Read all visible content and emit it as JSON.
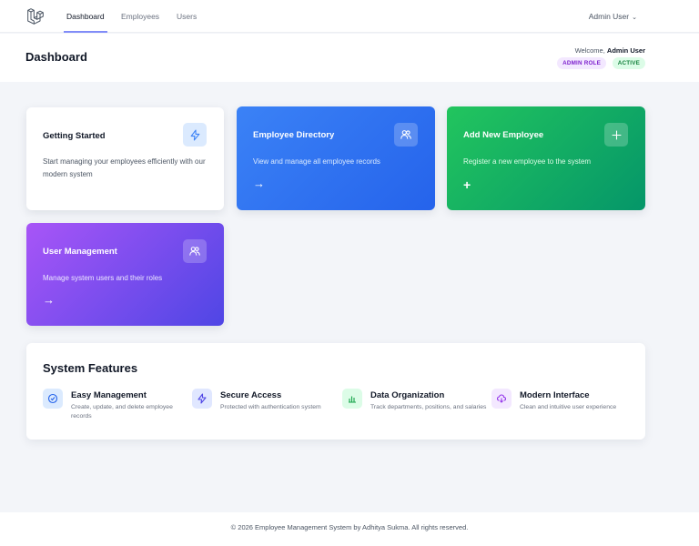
{
  "nav": {
    "logo_icon": "laravel-logo-icon",
    "links": [
      "Dashboard",
      "Employees",
      "Users"
    ],
    "active": "Dashboard",
    "user_menu": "Admin User"
  },
  "header": {
    "title": "Dashboard",
    "welcome_prefix": "Welcome,",
    "welcome_name": "Admin User",
    "role_badge": "ADMIN ROLE",
    "status_badge": "ACTIVE"
  },
  "cards": {
    "getting_started": {
      "title": "Getting Started",
      "description": "Start managing your employees efficiently with our modern system",
      "icon": "lightning-icon"
    },
    "employee_directory": {
      "title": "Employee Directory",
      "description": "View and manage all employee records",
      "icon": "users-icon",
      "arrow": "→"
    },
    "add_employee": {
      "title": "Add New Employee",
      "description": "Register a new employee to the system",
      "icon": "plus-icon",
      "arrow": "+"
    },
    "user_management": {
      "title": "User Management",
      "description": "Manage system users and their roles",
      "icon": "users-icon",
      "arrow": "→"
    }
  },
  "features": {
    "title": "System Features",
    "items": [
      {
        "title": "Easy Management",
        "description": "Create, update, and delete employee records",
        "icon": "check-circle-icon",
        "color": "#2563eb",
        "bg": "#dbeafe"
      },
      {
        "title": "Secure Access",
        "description": "Protected with authentication system",
        "icon": "lightning-icon",
        "color": "#4f46e5",
        "bg": "#e0e7ff"
      },
      {
        "title": "Data Organization",
        "description": "Track departments, positions, and salaries",
        "icon": "bar-chart-icon",
        "color": "#16a34a",
        "bg": "#dcfce7"
      },
      {
        "title": "Modern Interface",
        "description": "Clean and intuitive user experience",
        "icon": "cloud-download-icon",
        "color": "#9333ea",
        "bg": "#f3e8ff"
      }
    ]
  },
  "footer": {
    "text": "© 2026 Employee Management System by Adhitya Sukma. All rights reserved."
  },
  "colors": {
    "accent": "#818cf8",
    "blue": "#2563eb",
    "green": "#059669",
    "purple": "#7c3aed"
  }
}
